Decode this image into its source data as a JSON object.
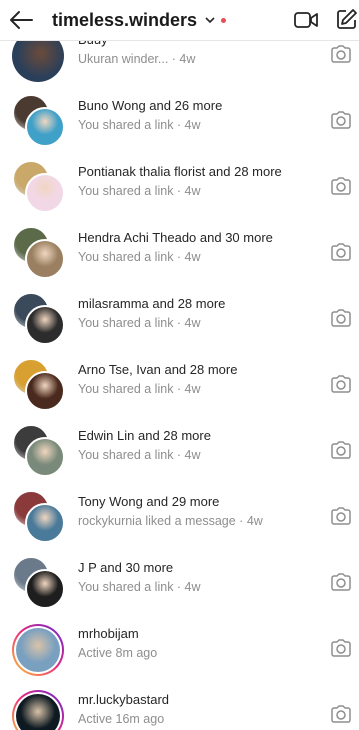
{
  "header": {
    "title": "timeless.winders",
    "icons": [
      "back-arrow-icon",
      "chevron-down-icon",
      "video-camera-icon",
      "compose-icon"
    ],
    "unread_dot_color": "#ed4956"
  },
  "threads": [
    {
      "name": "Buuy",
      "sub": "Ukuran winder... · 4w",
      "avatar_colors": [
        "#2a3f5a",
        "#6b4b3a"
      ],
      "type": "single"
    },
    {
      "name": "Buno Wong and 26 more",
      "sub": "You shared a link · 4w",
      "avatar_colors": [
        "#4a3a30",
        "#3fa0c8"
      ],
      "type": "group"
    },
    {
      "name": "Pontianak thalia florist and 28 more",
      "sub": "You shared a link · 4w",
      "avatar_colors": [
        "#c9a86a",
        "#f2d8e6"
      ],
      "type": "group"
    },
    {
      "name": "Hendra Achi Theado and 30 more",
      "sub": "You shared a link · 4w",
      "avatar_colors": [
        "#5b6b4a",
        "#9a8060"
      ],
      "type": "group"
    },
    {
      "name": "milasramma and 28 more",
      "sub": "You shared a link · 4w",
      "avatar_colors": [
        "#3a4a5a",
        "#2c2c2c"
      ],
      "type": "group"
    },
    {
      "name": "Arno Tse, Ivan and 28 more",
      "sub": "You shared a link · 4w",
      "avatar_colors": [
        "#d8a030",
        "#4a2a1e"
      ],
      "type": "group"
    },
    {
      "name": "Edwin Lin and 28 more",
      "sub": "You shared a link · 4w",
      "avatar_colors": [
        "#3c3c3c",
        "#7a8a7a"
      ],
      "type": "group"
    },
    {
      "name": "Tony Wong and 29 more",
      "sub": "rockykurnia liked a message · 4w",
      "avatar_colors": [
        "#8a3a3a",
        "#4a7a9a"
      ],
      "type": "group"
    },
    {
      "name": "J P and 30 more",
      "sub": "You shared a link · 4w",
      "avatar_colors": [
        "#6a7a8a",
        "#1e1e1e"
      ],
      "type": "group"
    },
    {
      "name": "mrhobijam",
      "sub": "Active 8m ago",
      "avatar_colors": [
        "#7aa0c0",
        "#7aa0c0"
      ],
      "type": "ring"
    },
    {
      "name": "mr.luckybastard",
      "sub": "Active 16m ago",
      "avatar_colors": [
        "#0e1a22",
        "#0e1a22"
      ],
      "type": "ring"
    }
  ]
}
